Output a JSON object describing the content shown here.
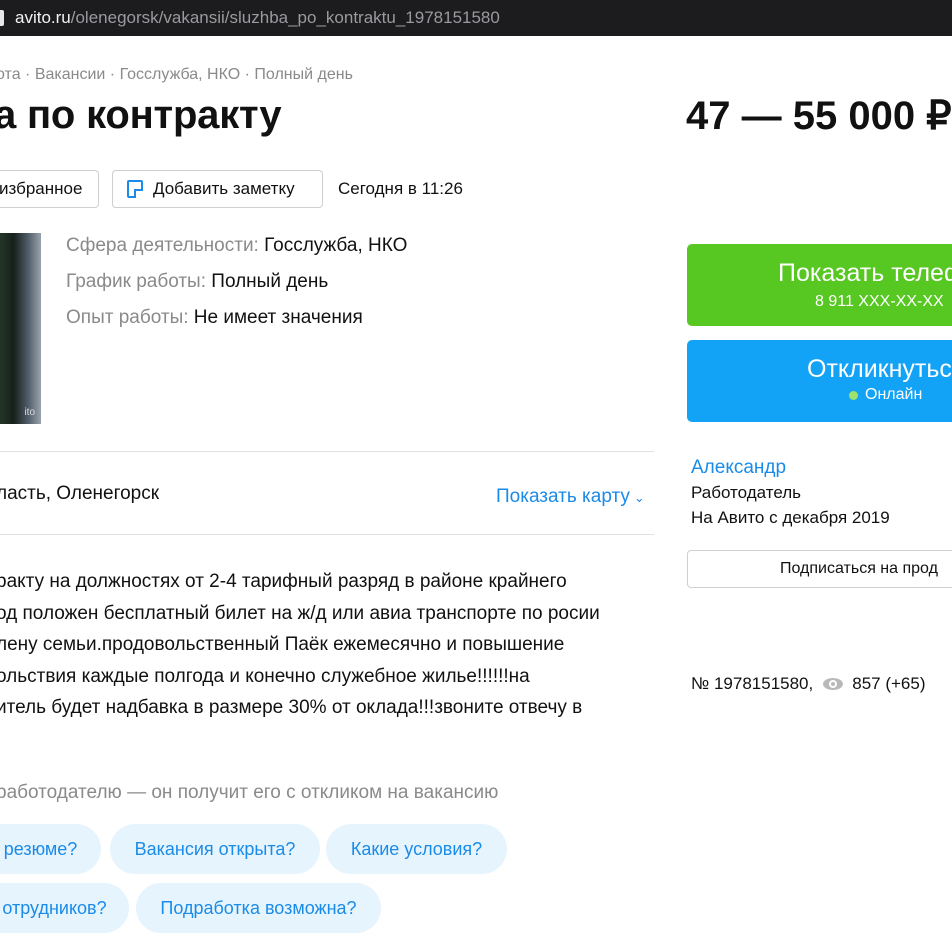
{
  "browser": {
    "url_domain": "avito.ru",
    "url_path": "/olenegorsk/vakansii/sluzhba_po_kontraktu_1978151580"
  },
  "breadcrumb": "ота · Вакансии · Госслужба, НКО · Полный день",
  "title": "а по контракту",
  "price": "47 — 55 000 ₽",
  "actions": {
    "favorite": "избранное",
    "note": "Добавить заметку",
    "date": "Сегодня в 11:26"
  },
  "params": [
    {
      "label": "Сфера деятельности:",
      "value": "Госслужба, НКО"
    },
    {
      "label": "График работы:",
      "value": "Полный день"
    },
    {
      "label": "Опыт работы:",
      "value": "Не имеет значения"
    }
  ],
  "address": "ласть, Оленегорск",
  "map_link": "Показать карту",
  "description_lines": [
    "ракту на должностях от 2-4 тарифный разряд в районе крайнего",
    "од положен бесплатный билет на ж/д или авиа транспорте по росии",
    "лену семьи.продовольственный Паёк ежемесячно и повышение",
    "ольствия каждые полгода и конечно служебное жилье!!!!!!на",
    "итель будет надбавка в размере 30% от оклада!!!звоните отвечу в"
  ],
  "ask_hint": "работодателю — он получит его с откликом на вакансию",
  "quick_questions": [
    "резюме?",
    "Вакансия открыта?",
    "Какие условия?",
    "отрудников?",
    "Подработка возможна?"
  ],
  "sidebar": {
    "phone_button": "Показать телеф",
    "phone_number": "8 911 XXX-XX-XX",
    "reply_button": "Откликнуться",
    "online": "Онлайн",
    "seller_name": "Александр",
    "seller_role": "Работодатель",
    "seller_since": "На Авито с декабря 2019",
    "subscribe": "Подписаться на прод",
    "ad_number": "№ 1978151580,",
    "views": "857 (+65)"
  },
  "colors": {
    "accent_blue": "#1a8be8",
    "phone_green": "#57c722",
    "reply_blue": "#13a3f6",
    "chip_bg": "#e6f4fd"
  }
}
